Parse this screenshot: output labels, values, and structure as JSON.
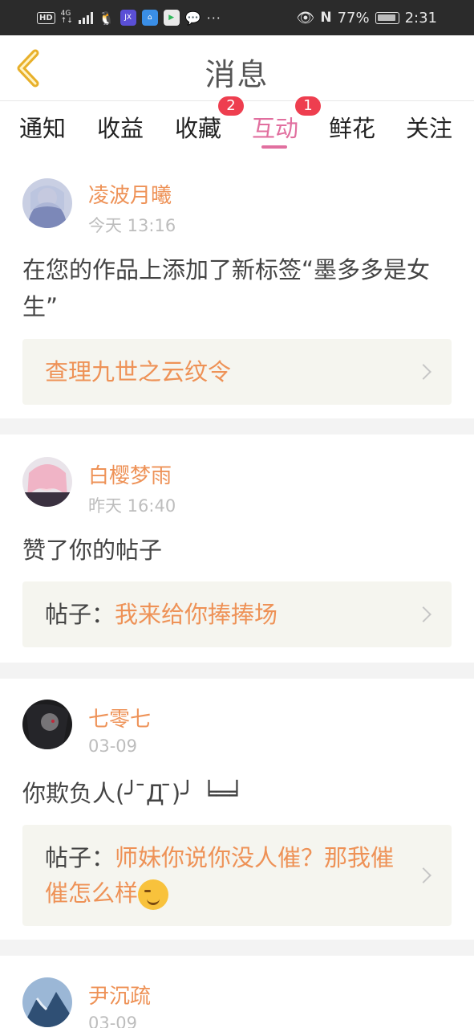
{
  "status_bar": {
    "net_type": "HD",
    "signal_label": "4G",
    "battery": "77%",
    "time": "2:31",
    "icons": [
      "qq-icon",
      "app-icon",
      "map-icon",
      "video-icon",
      "wechat-icon",
      "eye-icon",
      "nfc-icon"
    ]
  },
  "header": {
    "title": "消息",
    "back_icon": "chevron-left-icon"
  },
  "tabs": [
    {
      "label": "通知",
      "badge": ""
    },
    {
      "label": "收益",
      "badge": ""
    },
    {
      "label": "收藏",
      "badge": "2"
    },
    {
      "label": "互动",
      "badge": "1",
      "active": true
    },
    {
      "label": "鲜花",
      "badge": ""
    },
    {
      "label": "关注",
      "badge": ""
    }
  ],
  "messages": [
    {
      "name": "凌波月曦",
      "time": "今天 13:16",
      "text": "在您的作品上添加了新标签“墨多多是女生”",
      "ref_prefix": "",
      "ref_title": "查理九世之云纹令"
    },
    {
      "name": "白樱梦雨",
      "time": "昨天 16:40",
      "text": "赞了你的帖子",
      "ref_prefix": "帖子：",
      "ref_title": "我来给你捧捧场"
    },
    {
      "name": "七零七",
      "time": "03-09",
      "text": "你欺负人(╯ ̄Д ̄)╯ ╘═╛",
      "ref_prefix": "帖子：",
      "ref_title": "师妹你说你没人催？那我催催怎么样"
    },
    {
      "name": "尹沉疏",
      "time": "03-09"
    }
  ],
  "colors": {
    "accent": "#e16f9f",
    "name": "#ee9257",
    "badge": "#ee3e4f"
  }
}
